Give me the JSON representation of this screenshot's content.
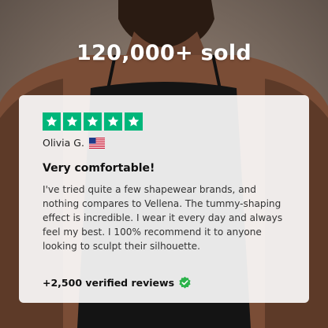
{
  "headline": "120,000+ sold",
  "review": {
    "rating_stars": 5,
    "star_color": "#00b67a",
    "reviewer_name": "Olivia G.",
    "reviewer_country_flag": "us-flag-icon",
    "title": "Very comfortable!",
    "body": "I've tried quite a few shapewear brands, and nothing compares to Vellena. The tummy-shaping effect is incredible. I wear it every day and always feel my best. I 100% recommend it to anyone looking to sculpt their silhouette."
  },
  "footer": {
    "verified_text": "+2,500 verified reviews",
    "badge_icon": "verified-check-icon",
    "badge_color": "#2bb34a"
  }
}
